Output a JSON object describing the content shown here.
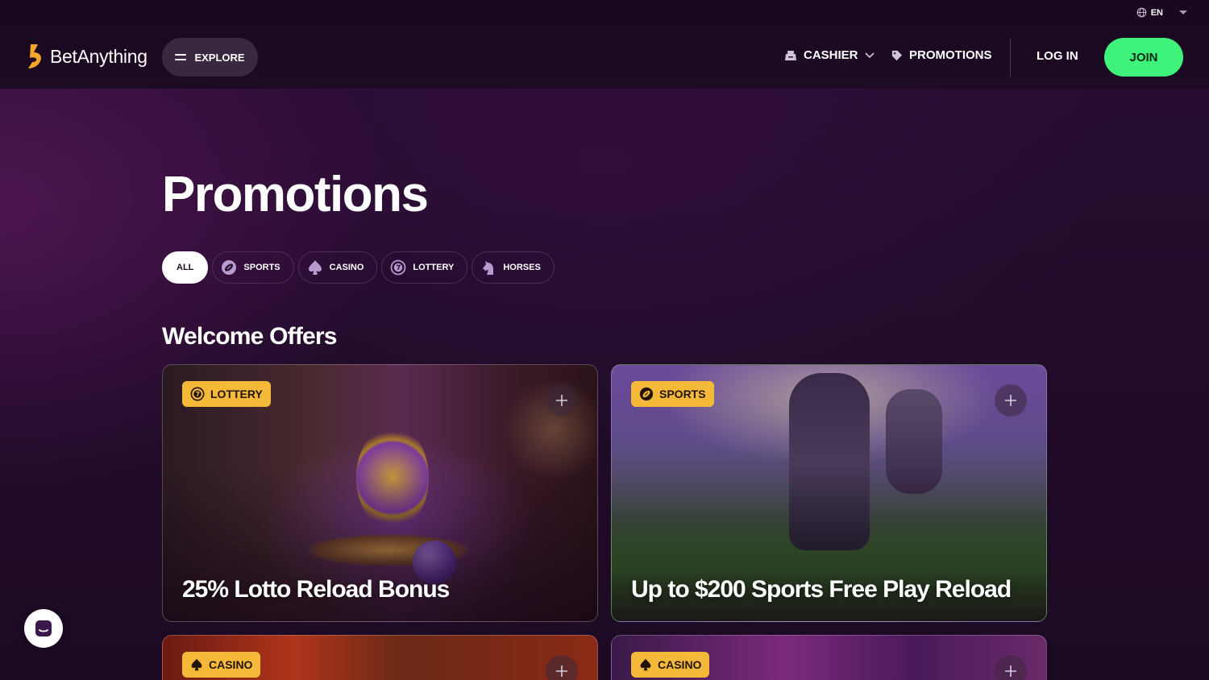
{
  "header": {
    "language": "EN",
    "logo_text": "BetAnything",
    "explore_label": "EXPLORE",
    "nav": {
      "cashier_label": "CASHIER",
      "promotions_label": "PROMOTIONS"
    },
    "login_label": "LOG IN",
    "join_label": "JOIN"
  },
  "page": {
    "title": "Promotions"
  },
  "filters": [
    {
      "label": "ALL",
      "icon": "none",
      "active": true
    },
    {
      "label": "SPORTS",
      "icon": "football-icon",
      "active": false
    },
    {
      "label": "CASINO",
      "icon": "spade-icon",
      "active": false
    },
    {
      "label": "LOTTERY",
      "icon": "lottery-ball-icon",
      "active": false
    },
    {
      "label": "HORSES",
      "icon": "horse-icon",
      "active": false
    }
  ],
  "section": {
    "title": "Welcome Offers"
  },
  "cards": [
    {
      "badge": "LOTTERY",
      "badge_icon": "lottery-ball-icon",
      "title": "25% Lotto Reload Bonus"
    },
    {
      "badge": "SPORTS",
      "badge_icon": "football-icon",
      "title": "Up to $200 Sports Free Play Reload"
    },
    {
      "badge": "CASINO",
      "badge_icon": "spade-icon",
      "title": ""
    },
    {
      "badge": "CASINO",
      "badge_icon": "spade-icon",
      "title": ""
    }
  ],
  "colors": {
    "accent_join": "#3ef27a",
    "badge": "#f5b93a",
    "background": "#1d0a24"
  }
}
